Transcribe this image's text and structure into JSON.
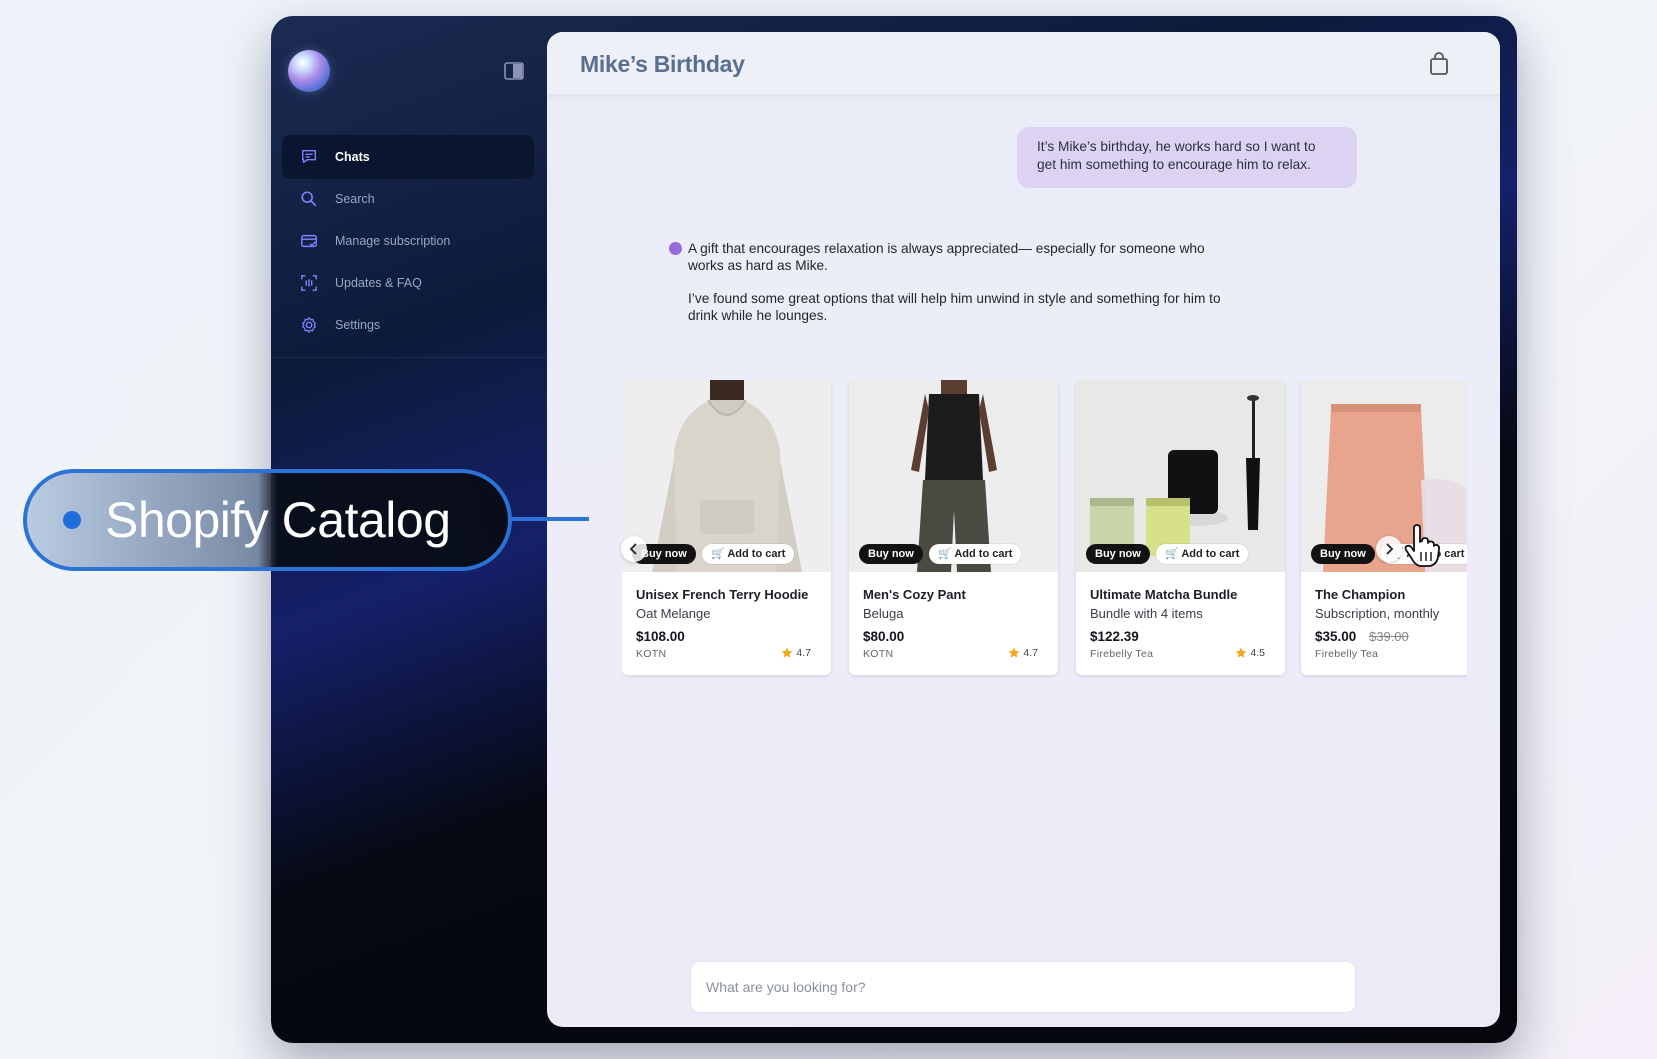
{
  "sidebar": {
    "items": [
      {
        "label": "Chats",
        "icon": "chat-icon",
        "active": true
      },
      {
        "label": "Search",
        "icon": "search-icon"
      },
      {
        "label": "Manage subscription",
        "icon": "card-icon"
      },
      {
        "label": "Updates & FAQ",
        "icon": "scan-icon"
      },
      {
        "label": "Settings",
        "icon": "gear-icon"
      }
    ]
  },
  "header": {
    "title": "Mike’s Birthday"
  },
  "chat": {
    "user_message": "It’s Mike’s birthday, he works hard so I want to get him something to encourage him to relax.",
    "assistant_paragraph_1": "A gift that encourages relaxation is always appreciated— especially for someone who works as hard as Mike.",
    "assistant_paragraph_2": "I’ve found some great options that will help him unwind in style and something for him to drink while he lounges."
  },
  "products": [
    {
      "name": "Unisex French Terry Hoodie",
      "variant": "Oat Melange",
      "price": "$108.00",
      "compare_price": "",
      "vendor": "KOTN",
      "rating": "4.7",
      "buy_label": "Buy now",
      "cart_label": "Add to cart"
    },
    {
      "name": "Men's Cozy Pant",
      "variant": "Beluga",
      "price": "$80.00",
      "compare_price": "",
      "vendor": "KOTN",
      "rating": "4.7",
      "buy_label": "Buy now",
      "cart_label": "Add to cart"
    },
    {
      "name": "Ultimate Matcha Bundle",
      "variant": "Bundle with 4 items",
      "price": "$122.39",
      "compare_price": "",
      "vendor": "Firebelly Tea",
      "rating": "4.5",
      "buy_label": "Buy now",
      "cart_label": "Add to cart"
    },
    {
      "name": "The Champion",
      "variant": "Subscription, monthly",
      "price": "$35.00",
      "compare_price": "$39.00",
      "vendor": "Firebelly Tea",
      "rating": "",
      "buy_label": "Buy now",
      "cart_label": "Add to cart"
    }
  ],
  "input": {
    "placeholder": "What are you looking for?"
  },
  "callout": {
    "label": "Shopify Catalog"
  },
  "colors": {
    "accent": "#2b73d6",
    "user_bubble": "#dcd3f3",
    "assistant_dot": "#9a6ad8"
  }
}
